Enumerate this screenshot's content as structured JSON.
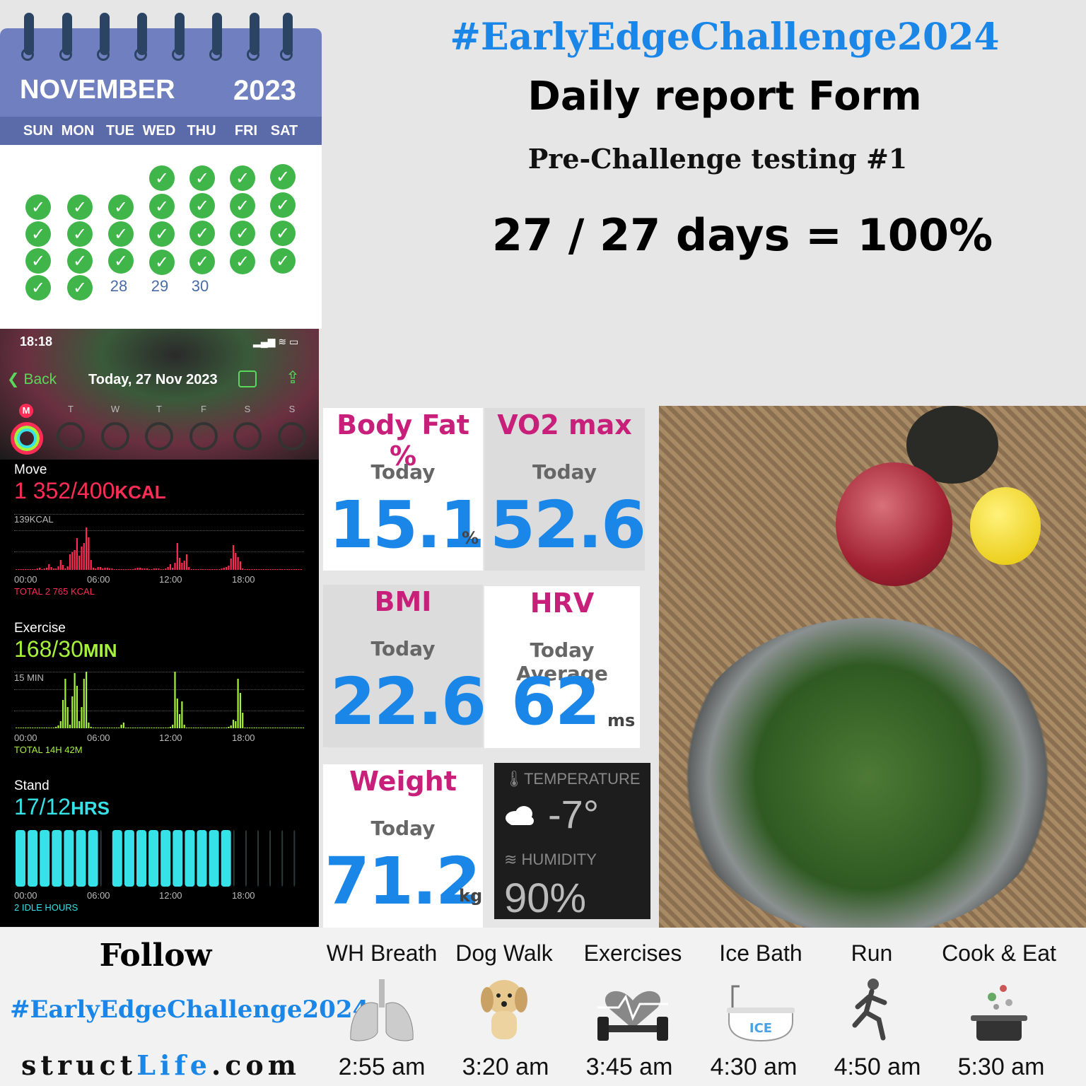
{
  "header": {
    "hashtag": "#EarlyEdgeChallenge2024",
    "title": "Daily report Form",
    "subtitle": "Pre-Challenge testing #1",
    "score": "27 / 27 days = 100%"
  },
  "calendar": {
    "month": "NOVEMBER",
    "year": "2023",
    "weekdays": [
      "SUN",
      "MON",
      "TUE",
      "WED",
      "THU",
      "FRI",
      "SAT"
    ],
    "unchecked_days": [
      "28",
      "29",
      "30"
    ],
    "check_icon": "check-circle-icon",
    "check_color": "#3fb54a"
  },
  "phone": {
    "time": "18:18",
    "back_label": "Back",
    "date": "Today, 27 Nov 2023",
    "week_days": [
      "M",
      "T",
      "W",
      "T",
      "F",
      "S",
      "S"
    ],
    "move": {
      "label": "Move",
      "value": "1 352/400",
      "unit": "KCAL",
      "max_tick": "139KCAL",
      "total": "TOTAL 2 765 KCAL",
      "color": "#ff2d55"
    },
    "exercise": {
      "label": "Exercise",
      "value": "168/30",
      "unit": "MIN",
      "max_tick": "15 MIN",
      "total": "TOTAL 14H 42M",
      "color": "#a6f23a"
    },
    "stand": {
      "label": "Stand",
      "value": "17/12",
      "unit": "HRS",
      "total": "2 IDLE HOURS",
      "color": "#36e2e8"
    },
    "time_ticks": [
      "00:00",
      "06:00",
      "12:00",
      "18:00"
    ]
  },
  "metrics": {
    "body_fat": {
      "title": "Body Fat %",
      "period": "Today",
      "value": "15.1",
      "unit": "%"
    },
    "vo2max": {
      "title": "VO2 max",
      "period": "Today",
      "value": "52.6"
    },
    "bmi": {
      "title": "BMI",
      "period": "Today",
      "value": "22.6"
    },
    "hrv": {
      "title": "HRV",
      "period": "Today Average",
      "value": "62",
      "unit": "ms"
    },
    "weight": {
      "title": "Weight",
      "period": "Today",
      "value": "71.2",
      "unit": "kg"
    }
  },
  "weather": {
    "temp_label": "TEMPERATURE",
    "temp_value": "-7°",
    "humidity_label": "HUMIDITY",
    "humidity_value": "90%",
    "icon": "cloud-icon"
  },
  "footer": {
    "follow": "Follow",
    "hashtag": "#EarlyEdgeChallenge2024",
    "site_a": "struct",
    "site_b": "Life",
    "site_c": ".com",
    "activities": [
      {
        "label": "WH Breath",
        "time": "2:55 am",
        "icon": "lungs-icon"
      },
      {
        "label": "Dog Walk",
        "time": "3:20 am",
        "icon": "dog-icon"
      },
      {
        "label": "Exercises",
        "time": "3:45 am",
        "icon": "dumbbell-icon"
      },
      {
        "label": "Ice Bath",
        "time": "4:30 am",
        "icon": "bathtub-icon",
        "icon_text": "ICE"
      },
      {
        "label": "Run",
        "time": "4:50 am",
        "icon": "runner-icon"
      },
      {
        "label": "Cook & Eat",
        "time": "5:30 am",
        "icon": "cooking-pot-icon"
      }
    ]
  }
}
